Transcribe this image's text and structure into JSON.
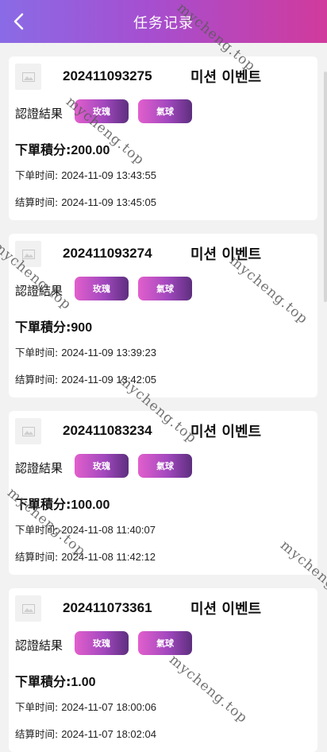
{
  "header": {
    "title": "任务记录"
  },
  "watermark_text": "mycheng.top",
  "records": [
    {
      "order_no": "202411093275",
      "event": "미션 이벤트",
      "result_label": "認證結果",
      "tags": [
        "玫瑰",
        "氣球"
      ],
      "points_label": "下單積分:",
      "points": "200.00",
      "order_time_label": "下单时间:",
      "order_time": "2024-11-09 13:43:55",
      "settle_time_label": "结算时间:",
      "settle_time": "2024-11-09 13:45:05"
    },
    {
      "order_no": "202411093274",
      "event": "미션 이벤트",
      "result_label": "認證結果",
      "tags": [
        "玫瑰",
        "氣球"
      ],
      "points_label": "下單積分:",
      "points": "900",
      "order_time_label": "下单时间:",
      "order_time": "2024-11-09 13:39:23",
      "settle_time_label": "结算时间:",
      "settle_time": "2024-11-09 13:42:05"
    },
    {
      "order_no": "202411083234",
      "event": "미션 이벤트",
      "result_label": "認證結果",
      "tags": [
        "玫瑰",
        "氣球"
      ],
      "points_label": "下單積分:",
      "points": "100.00",
      "order_time_label": "下单时间:",
      "order_time": "2024-11-08 11:40:07",
      "settle_time_label": "结算时间:",
      "settle_time": "2024-11-08 11:42:12"
    },
    {
      "order_no": "202411073361",
      "event": "미션 이벤트",
      "result_label": "認證結果",
      "tags": [
        "玫瑰",
        "氣球"
      ],
      "points_label": "下單積分:",
      "points": "1.00",
      "order_time_label": "下单时间:",
      "order_time": "2024-11-07 18:00:06",
      "settle_time_label": "结算时间:",
      "settle_time": "2024-11-07 18:02:04"
    }
  ]
}
